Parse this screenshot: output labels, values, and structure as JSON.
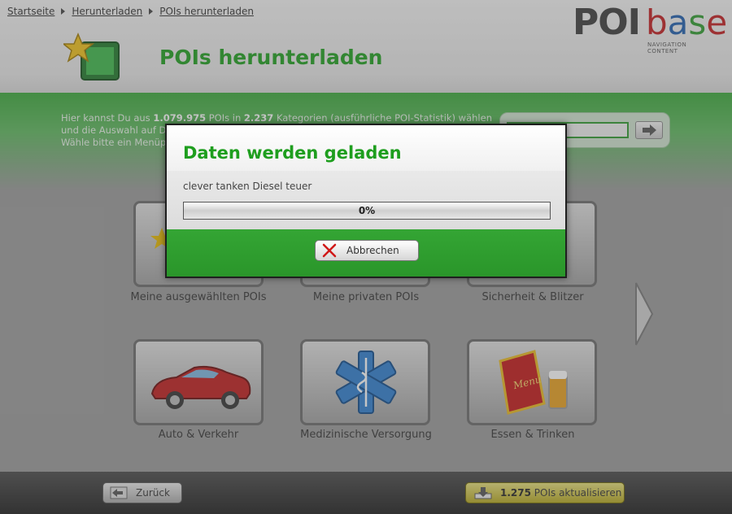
{
  "breadcrumb": [
    "Startseite",
    "Herunterladen",
    "POIs herunterladen"
  ],
  "logo": {
    "poi": "POI",
    "base": "base",
    "subtitle": "NAVIGATION CONTENT"
  },
  "page": {
    "title": "POIs herunterladen"
  },
  "intro": {
    "line1_prefix": "Hier kannst Du aus ",
    "poi_count": "1.079.975",
    "line1_mid": " POIs in ",
    "category_count": "2.237",
    "line1_suffix": " Kategorien (ausführliche POI-Statistik) wählen",
    "line2": "und die Auswahl auf De",
    "line3": "Wähle bitte ein Menüp"
  },
  "search": {
    "placeholder": "..."
  },
  "tiles": [
    {
      "label": "Meine ausgewählten POIs",
      "icon": "star-folder-icon"
    },
    {
      "label": "Meine privaten POIs",
      "icon": "private-folder-icon"
    },
    {
      "label": "Sicherheit & Blitzer",
      "icon": "speed-camera-icon"
    },
    {
      "label": "Auto & Verkehr",
      "icon": "car-icon"
    },
    {
      "label": "Medizinische Versorgung",
      "icon": "star-of-life-icon"
    },
    {
      "label": "Essen & Trinken",
      "icon": "menu-beer-icon"
    }
  ],
  "footer": {
    "back_label": "Zurück",
    "update_count": "1.275",
    "update_label": " POIs aktualisieren"
  },
  "modal": {
    "title": "Daten werden geladen",
    "status": "clever tanken Diesel teuer",
    "progress_percent": 0,
    "progress_text": "0%",
    "cancel_label": "Abbrechen"
  },
  "colors": {
    "brand_green": "#1e9e1e",
    "band_green": "#3aa93a",
    "update_yellow": "#d4c94a"
  }
}
